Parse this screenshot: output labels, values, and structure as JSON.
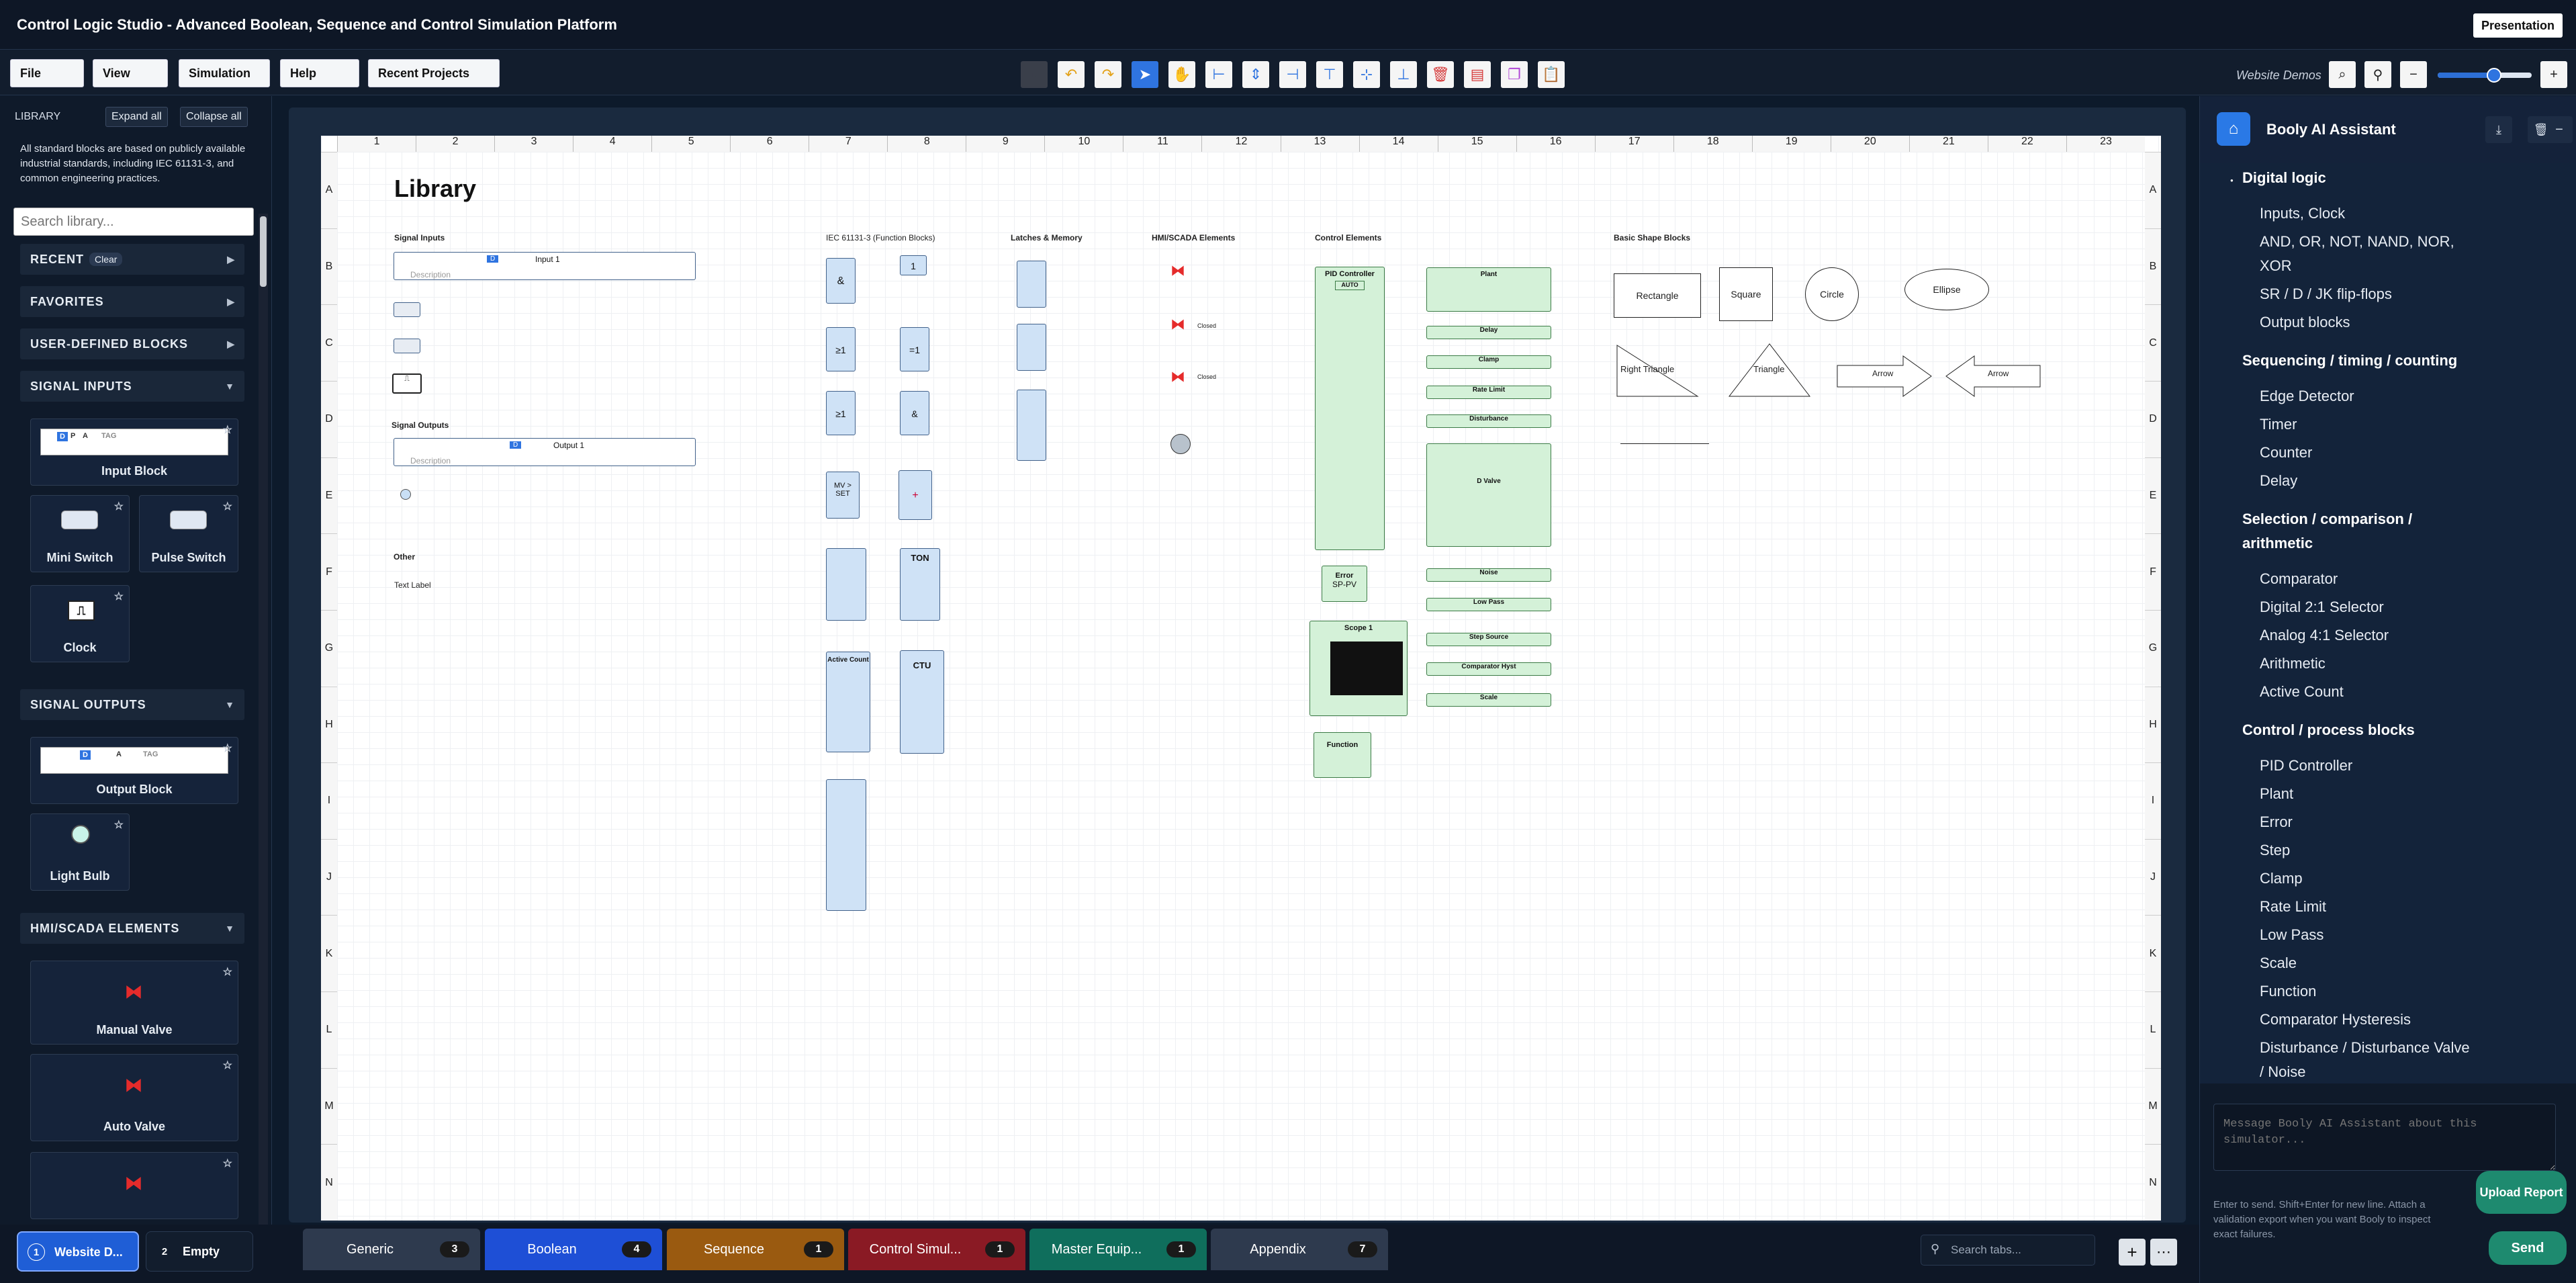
{
  "app": {
    "title": "Control Logic Studio - Advanced Boolean, Sequence and Control Simulation Platform",
    "presentation_label": "Presentation"
  },
  "menu": {
    "file": "File",
    "view": "View",
    "simulation": "Simulation",
    "help": "Help",
    "recent_projects": "Recent Projects",
    "website_demos": "Website Demos"
  },
  "toolbar_icons": [
    "square-icon",
    "undo-icon",
    "redo-icon",
    "select-pointer-icon",
    "pan-hand-icon",
    "align-left-icon",
    "align-center-icon",
    "align-right-icon",
    "align-top-icon",
    "align-middle-icon",
    "align-bottom-icon",
    "delete-icon",
    "export-pdf-icon",
    "duplicate-icon",
    "clipboard-icon"
  ],
  "zoom": {
    "level": 0.6
  },
  "library": {
    "header": "LIBRARY",
    "expand_all": "Expand all",
    "collapse_all": "Collapse all",
    "info": "All standard blocks are based on publicly available industrial standards, including IEC 61131-3, and common engineering practices.",
    "search_placeholder": "Search library...",
    "recent": "RECENT",
    "clear": "Clear",
    "favorites": "FAVORITES",
    "user_defined": "USER-DEFINED BLOCKS",
    "signal_inputs": "SIGNAL INPUTS",
    "signal_outputs": "SIGNAL OUTPUTS",
    "hmi": "HMI/SCADA ELEMENTS",
    "input_block": "Input Block",
    "mini_switch": "Mini Switch",
    "pulse_switch": "Pulse Switch",
    "clock": "Clock",
    "output_block": "Output Block",
    "light_bulb": "Light Bulb",
    "manual_valve": "Manual Valve",
    "auto_valve": "Auto Valve",
    "preview_d": "D",
    "preview_p": "P",
    "preview_a": "A",
    "preview_tag": "TAG"
  },
  "grid": {
    "columns": [
      "1",
      "2",
      "3",
      "4",
      "5",
      "6",
      "7",
      "8",
      "9",
      "10",
      "11",
      "12",
      "13",
      "14",
      "15",
      "16",
      "17",
      "18",
      "19",
      "20",
      "21",
      "22",
      "23"
    ],
    "rows": [
      "A",
      "B",
      "C",
      "D",
      "E",
      "F",
      "G",
      "H",
      "I",
      "J",
      "K",
      "L",
      "M",
      "N"
    ]
  },
  "canvas": {
    "title": "Library",
    "signal_inputs": "Signal Inputs",
    "signal_outputs": "Signal Outputs",
    "other": "Other",
    "text_label": "Text Label",
    "input_1": "Input 1",
    "output_1": "Output 1",
    "description": "Description",
    "iec": "IEC 61131-3 (Function Blocks)",
    "latches": "Latches & Memory",
    "hmi": "HMI/SCADA Elements",
    "control": "Control Elements",
    "basic": "Basic Shape Blocks",
    "gate_and": "&",
    "gate_or": "≥1",
    "gate_xor": "=1",
    "gate_not": "1",
    "mv_set": "MV > SET",
    "ton": "TON",
    "ctu": "CTU",
    "active_count": "Active Count",
    "pid": "PID Controller",
    "auto": "AUTO",
    "error": "Error",
    "sp_pv": "SP-PV",
    "scope": "Scope 1",
    "function": "Function",
    "plant": "Plant",
    "delay": "Delay",
    "clamp": "Clamp",
    "rate_limit": "Rate Limit",
    "disturbance": "Disturbance",
    "d_valve": "D Valve",
    "noise": "Noise",
    "low_pass": "Low Pass",
    "step_source": "Step Source",
    "comparator": "Comparator Hyst",
    "scale": "Scale",
    "closed": "Closed",
    "rectangle": "Rectangle",
    "square": "Square",
    "circle": "Circle",
    "ellipse": "Ellipse",
    "right_triangle": "Right Triangle",
    "triangle": "Triangle",
    "arrow": "Arrow"
  },
  "assistant": {
    "title": "Booly AI Assistant",
    "sections": [
      {
        "title": "Digital logic",
        "items": [
          "Inputs, Clock",
          "AND, OR, NOT, NAND, NOR,",
          "XOR",
          "SR / D / JK flip-flops",
          "Output blocks"
        ]
      },
      {
        "title": "Sequencing / timing / counting",
        "items": [
          "Edge Detector",
          "Timer",
          "Counter",
          "Delay"
        ]
      },
      {
        "title": "Selection / comparison /",
        "title2": "arithmetic",
        "items": [
          "Comparator",
          "Digital 2:1 Selector",
          "Analog 4:1 Selector",
          "Arithmetic",
          "Active Count"
        ]
      },
      {
        "title": "Control / process blocks",
        "items": [
          "PID Controller",
          "Plant",
          "Error",
          "Step",
          "Clamp",
          "Rate Limit",
          "Low Pass",
          "Scale",
          "Function",
          "Comparator Hysteresis",
          "Disturbance / Disturbance Valve",
          "/ Noise"
        ]
      }
    ],
    "input_placeholder": "Message Booly AI Assistant about this simulator...",
    "hint": "Enter to send. Shift+Enter for new line. Attach a validation export when you want Booly to inspect exact failures.",
    "upload_report": "Upload Report",
    "send": "Send"
  },
  "projects": [
    {
      "num": "1",
      "name": "Website D..."
    },
    {
      "num": "2",
      "name": "Empty"
    }
  ],
  "tabs": [
    {
      "label": "Generic",
      "count": "3",
      "color": "#2e3a4e"
    },
    {
      "label": "Boolean",
      "count": "4",
      "color": "#1e4fd6"
    },
    {
      "label": "Sequence",
      "count": "1",
      "color": "#9a5a10"
    },
    {
      "label": "Control Simul...",
      "count": "1",
      "color": "#8a1a24"
    },
    {
      "label": "Master Equip...",
      "count": "1",
      "color": "#0f6e5c"
    },
    {
      "label": "Appendix",
      "count": "7",
      "color": "#2e3a4e"
    }
  ],
  "tab_search_placeholder": "Search tabs...",
  "colors": {
    "accent": "#1f5ed6",
    "send": "#1e8a6f"
  }
}
